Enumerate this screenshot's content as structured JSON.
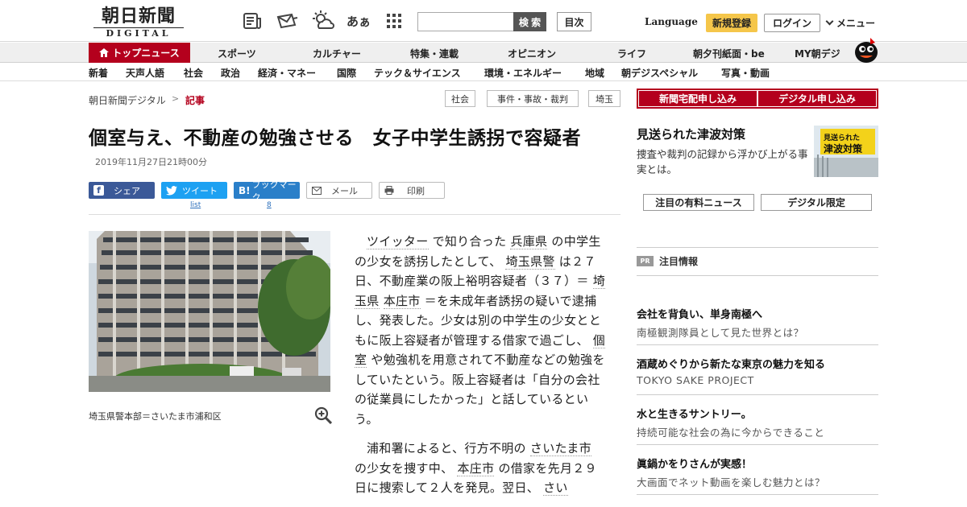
{
  "header": {
    "logo_main": "朝日新聞",
    "logo_sub": "DIGITAL",
    "icons": [
      "newspaper-icon",
      "mail-bag-icon",
      "weather-icon",
      "font-size-icon",
      "grid-icon"
    ],
    "font_size_label": "あぁ",
    "search_placeholder": "",
    "search_button": "検 索",
    "index_button": "目次",
    "language": "Language",
    "signup": "新規登録",
    "login": "ログイン",
    "menu": "メニュー"
  },
  "nav_primary": {
    "top_news": "トップニュース",
    "items": [
      "スポーツ",
      "カルチャー",
      "特集・連載",
      "オピニオン",
      "ライフ",
      "朝夕刊紙面・be",
      "MY朝デジ"
    ]
  },
  "nav_secondary": {
    "items": [
      "新着",
      "天声人語",
      "社会",
      "政治",
      "経済・マネー",
      "国際",
      "テック＆サイエンス",
      "環境・エネルギー",
      "地域",
      "朝デジスペシャル",
      "写真・動画"
    ]
  },
  "breadcrumb": {
    "home": "朝日新聞デジタル",
    "separator": ">",
    "current": "記事",
    "tags": [
      "社会",
      "事件・事故・裁判",
      "埼玉"
    ]
  },
  "article": {
    "headline": "個室与え、不動産の勉強させる　女子中学生誘拐で容疑者",
    "date": "2019年11月27日21時00分",
    "share": {
      "facebook": "シェア",
      "twitter": "ツイート",
      "twitter_count": "list",
      "hatena": "ブックマーク",
      "hatena_count": "8",
      "mail": "メール",
      "print": "印刷"
    },
    "caption": "埼玉県警本部＝さいたま市浦和区",
    "p1": [
      {
        "t": "ツイッター",
        "link": true
      },
      {
        "t": " で知り合った ",
        "link": false
      },
      {
        "t": "兵庫県",
        "link": true
      },
      {
        "t": " の中学生の少女を誘拐したとして、 ",
        "link": false
      },
      {
        "t": "埼玉県警",
        "link": true
      },
      {
        "t": " は２７日、不動産業の阪上裕明容疑者（３７）＝ ",
        "link": false
      },
      {
        "t": "埼玉県",
        "link": true
      },
      {
        "t": " ",
        "link": false
      },
      {
        "t": "本庄市",
        "link": true
      },
      {
        "t": " ＝を未成年者誘拐の疑いで逮捕し、発表した。少女は別の中学生の少女とともに阪上容疑者が管理する借家で過ごし、 ",
        "link": false
      },
      {
        "t": "個室",
        "link": true
      },
      {
        "t": " や勉強机を用意されて不動産などの勉強をしていたという。阪上容疑者は「自分の会社の従業員にしたかった」と話しているという。",
        "link": false
      }
    ],
    "p2": [
      {
        "t": "浦和署によると、行方不明の ",
        "link": false
      },
      {
        "t": "さいたま市",
        "link": true
      },
      {
        "t": " の少女を捜す中、 ",
        "link": false
      },
      {
        "t": "本庄市",
        "link": true
      },
      {
        "t": " の借家を先月２９日に捜索して２人を発見。翌日、 ",
        "link": false
      },
      {
        "t": "さい",
        "link": true
      }
    ]
  },
  "sidebar": {
    "subscribe_paper": "新聞宅配申し込み",
    "subscribe_digital": "デジタル申し込み",
    "promo_title": "見送られた津波対策",
    "promo_desc": "捜査や裁判の記録から浮かび上がる事実とは。",
    "promo_img_line1": "見送られた",
    "promo_img_line2": "津波対策",
    "btn_paid_news": "注目の有料ニュース",
    "btn_digital_only": "デジタル限定",
    "pr_badge": "PR",
    "pr_title": "注目情報",
    "items": [
      {
        "title": "会社を背負い、単身南極へ",
        "sub": "南極観測隊員として見た世界とは？"
      },
      {
        "title": "酒蔵めぐりから新たな東京の魅力を知る",
        "sub": "TOKYO SAKE PROJECT"
      },
      {
        "title": "水と生きるサントリー。",
        "sub": "持続可能な社会の為に今からできること"
      },
      {
        "title": "眞鍋かをりさんが実感！",
        "sub": "大画面でネット動画を楽しむ魅力とは？"
      }
    ]
  },
  "colors": {
    "brand_red": "#b4001d",
    "signup_yellow": "#f5c64a",
    "facebook": "#3b5998",
    "twitter": "#1da1f2",
    "hatena": "#2a7fc9"
  }
}
